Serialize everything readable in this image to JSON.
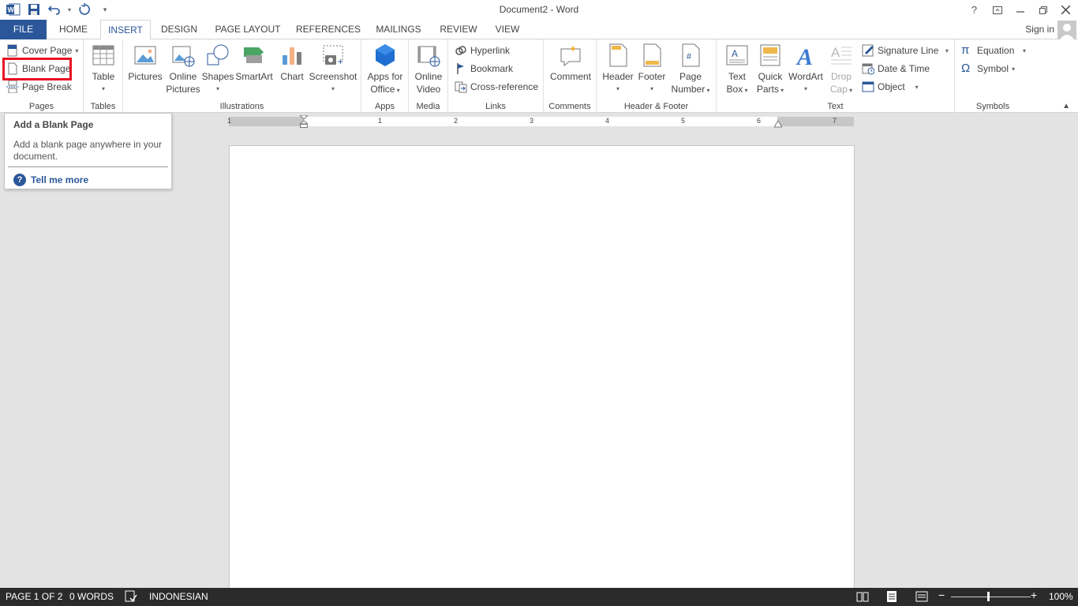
{
  "window": {
    "title": "Document2 - Word",
    "help": "?",
    "sign_in": "Sign in"
  },
  "tabs": [
    {
      "label": "FILE"
    },
    {
      "label": "HOME"
    },
    {
      "label": "INSERT"
    },
    {
      "label": "DESIGN"
    },
    {
      "label": "PAGE LAYOUT"
    },
    {
      "label": "REFERENCES"
    },
    {
      "label": "MAILINGS"
    },
    {
      "label": "REVIEW"
    },
    {
      "label": "VIEW"
    }
  ],
  "ribbon": {
    "pages": {
      "label": "Pages",
      "cover_page": "Cover Page",
      "blank_page": "Blank Page",
      "page_break": "Page Break"
    },
    "tables": {
      "label": "Tables",
      "table": "Table"
    },
    "illustrations": {
      "label": "Illustrations",
      "pictures": "Pictures",
      "online_pictures_1": "Online",
      "online_pictures_2": "Pictures",
      "shapes": "Shapes",
      "smartart": "SmartArt",
      "chart": "Chart",
      "screenshot": "Screenshot"
    },
    "apps": {
      "label": "Apps",
      "apps_1": "Apps for",
      "apps_2": "Office"
    },
    "media": {
      "label": "Media",
      "video_1": "Online",
      "video_2": "Video"
    },
    "links": {
      "label": "Links",
      "hyperlink": "Hyperlink",
      "bookmark": "Bookmark",
      "cross_reference": "Cross-reference"
    },
    "comments": {
      "label": "Comments",
      "comment": "Comment"
    },
    "header_footer": {
      "label": "Header & Footer",
      "header": "Header",
      "footer": "Footer",
      "page_number_1": "Page",
      "page_number_2": "Number"
    },
    "text": {
      "label": "Text",
      "text_box_1": "Text",
      "text_box_2": "Box",
      "quick_parts_1": "Quick",
      "quick_parts_2": "Parts",
      "wordart": "WordArt",
      "drop_cap_1": "Drop",
      "drop_cap_2": "Cap",
      "signature_line": "Signature Line",
      "date_time": "Date & Time",
      "object": "Object"
    },
    "symbols": {
      "label": "Symbols",
      "equation": "Equation",
      "symbol": "Symbol"
    }
  },
  "tooltip": {
    "title": "Add a Blank Page",
    "body": "Add a blank page anywhere in your document.",
    "more": "Tell me more"
  },
  "ruler": {
    "numbers": [
      "1",
      "1",
      "2",
      "3",
      "4",
      "5",
      "6",
      "7"
    ]
  },
  "status": {
    "page": "PAGE 1 OF 2",
    "words": "0 WORDS",
    "language": "INDONESIAN",
    "zoom": "100%"
  },
  "colors": {
    "accent": "#2b579a",
    "highlight": "#e81123",
    "statusbar": "#2b2b2b"
  }
}
